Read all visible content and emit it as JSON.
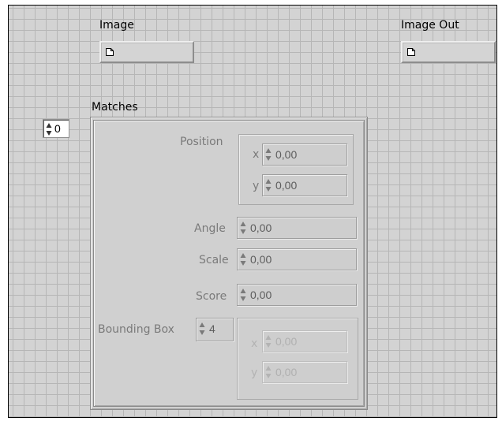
{
  "controls": {
    "image": {
      "label": "Image"
    },
    "image_out": {
      "label": "Image Out"
    }
  },
  "matches": {
    "label": "Matches",
    "index": "0",
    "position": {
      "label": "Position",
      "x_label": "x",
      "x_value": "0,00",
      "y_label": "y",
      "y_value": "0,00"
    },
    "angle": {
      "label": "Angle",
      "value": "0,00"
    },
    "scale": {
      "label": "Scale",
      "value": "0,00"
    },
    "score": {
      "label": "Score",
      "value": "0,00"
    },
    "bounding_box": {
      "label": "Bounding Box",
      "index": "4",
      "x_label": "x",
      "x_value": "0,00",
      "y_label": "y",
      "y_value": "0,00"
    }
  },
  "icons": {
    "file": "file-icon",
    "spin": "spin-arrows-icon"
  }
}
